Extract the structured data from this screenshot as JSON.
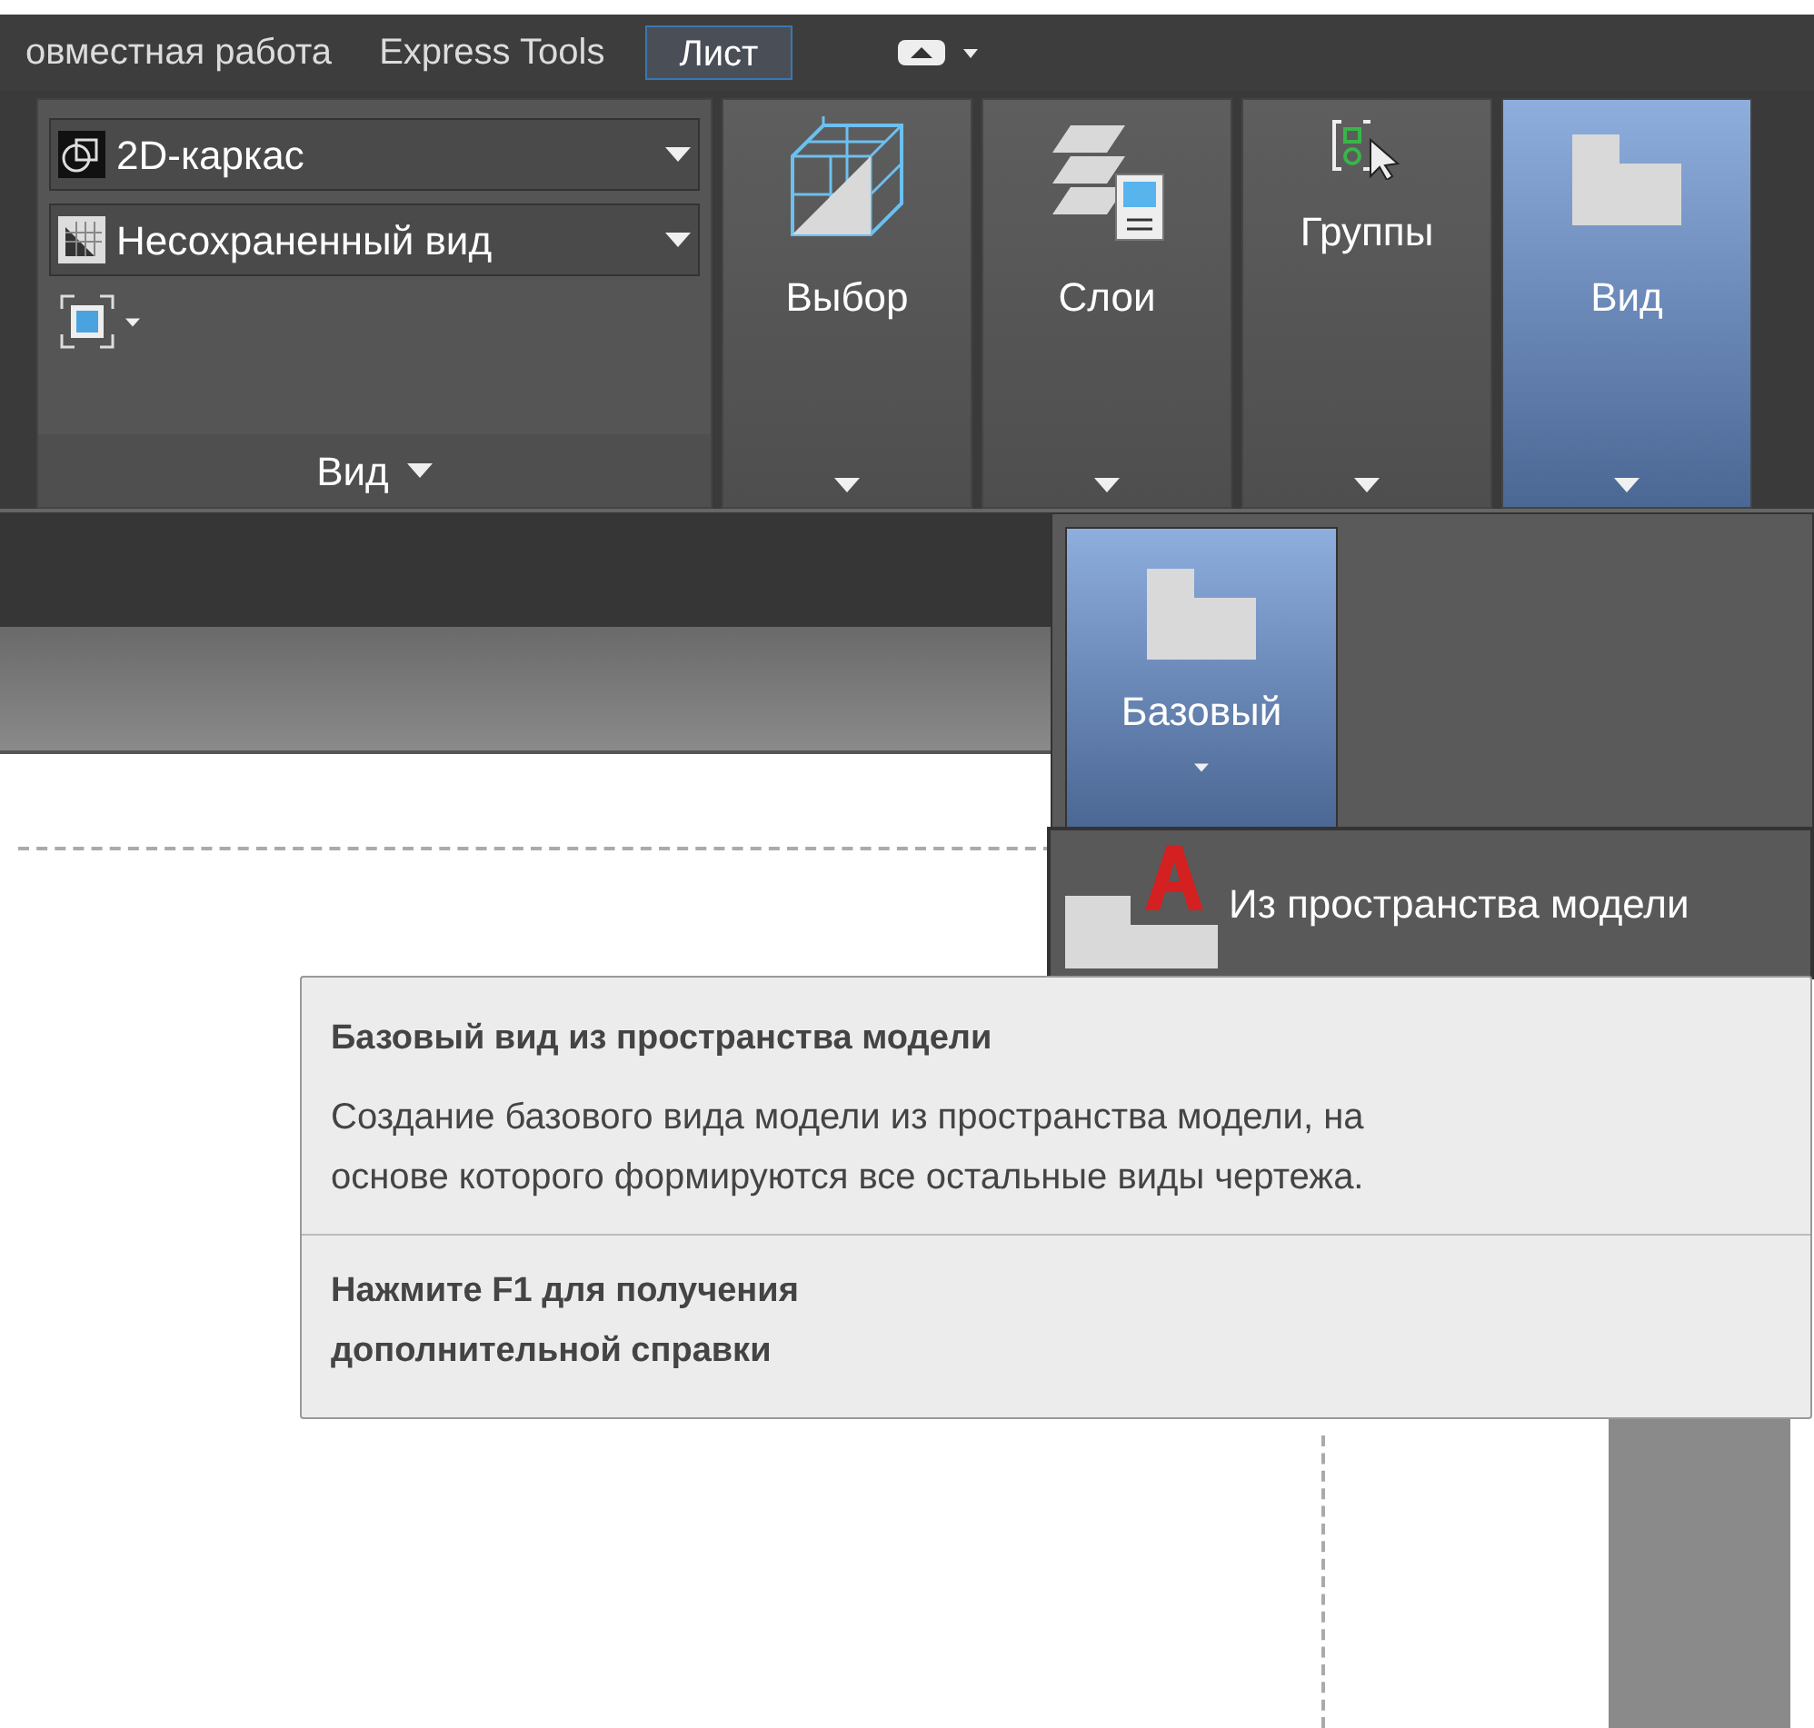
{
  "ribbon_tabs": [
    {
      "label": "овместная работа",
      "selected": false
    },
    {
      "label": "Express Tools",
      "selected": false
    },
    {
      "label": "Лист",
      "selected": true
    }
  ],
  "view_panel": {
    "visual_style": "2D-каркас",
    "named_view": "Несохраненный вид",
    "footer": "Вид"
  },
  "large_buttons": [
    {
      "label": "Выбор",
      "kind": "cube",
      "selected": false
    },
    {
      "label": "Слои",
      "kind": "layers",
      "selected": false
    },
    {
      "label": "Группы",
      "kind": "groups",
      "selected": false
    },
    {
      "label": "Вид",
      "kind": "view",
      "selected": true
    }
  ],
  "dropdown": {
    "button": "Базовый",
    "menu_item": "Из пространства модели"
  },
  "tooltip": {
    "title": "Базовый вид из пространства модели",
    "description": "Создание базового вида модели из пространства модели, на основе которого формируются все остальные виды чертежа.",
    "help_lines": [
      "Нажмите F1 для получения",
      "дополнительной справки"
    ]
  }
}
